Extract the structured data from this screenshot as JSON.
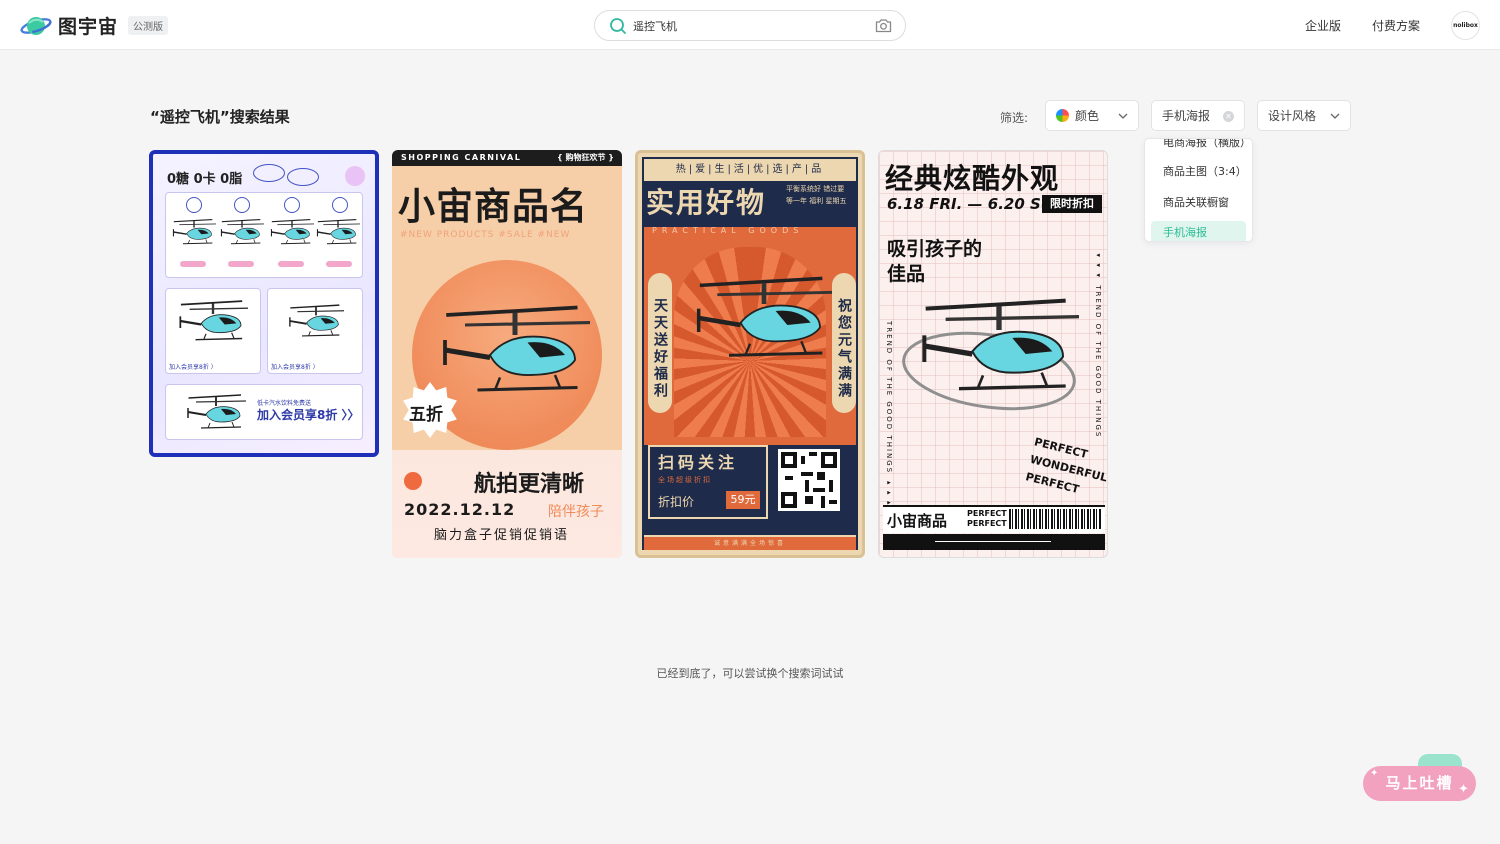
{
  "header": {
    "logo_text": "图宇宙",
    "beta_badge": "公测版",
    "search": {
      "value": "遥控飞机",
      "placeholder": ""
    },
    "nav": [
      "企业版",
      "付费方案"
    ],
    "avatar_text": "nolibox"
  },
  "results": {
    "title": "“遥控飞机”搜索结果",
    "filter_label": "筛选:",
    "filters": {
      "color": "颜色",
      "type": "手机海报",
      "style": "设计风格"
    },
    "dropdown": [
      "电商海报（横版）",
      "商品主图（3:4）",
      "商品关联橱窗",
      "手机海报"
    ],
    "dropdown_selected": "手机海报"
  },
  "cards": [
    {
      "head": "0糖 0卡 0脂",
      "member_small_1": "加入会员享8折 〉",
      "member_small_2": "加入会员享8折 〉",
      "promo_small": "低卡汽水饮料免费送",
      "promo_big": "加入会员享8折 〉〉"
    },
    {
      "top": "SHOPPING CARNIVAL",
      "top_right": "{ 购物狂欢节 }",
      "title": "小宙商品名",
      "sub": "#NEW PRODUCTS   #SALE   #NEW",
      "burst": "五折",
      "headline": "航拍更清晰",
      "date": "2022.12.12",
      "date_right": "陪伴孩子",
      "footer": "脑力盒子促销促销语"
    },
    {
      "stripe": "热|爱|生|活|优|选|产|品",
      "title": "实用好物",
      "mini": "平衡系统好 错过要等一年 福利 星期五",
      "practical": "PRACTICAL  GOODS",
      "left_vertical": "天天送好福利",
      "right_vertical": "祝您元气满满",
      "scan_title": "扫码关注",
      "scan_sub": "全场超级折扣",
      "scan_price_label": "折扣价",
      "price": "59元",
      "footer": "诚意满满全场惊喜"
    },
    {
      "title": "经典炫酷外观",
      "date": "6.18 FRI. — 6.20 SUN.",
      "tag": "限时折扣",
      "headline": "吸引孩子的佳品",
      "vertical_left": "TREND OF THE GOOD THINGS ▸▸▸",
      "vertical_right": "◂◂◂ TREND OF THE GOOD THINGS",
      "perfect": "PERFECT WONDERFUL PERFECT",
      "brand": "小宙商品",
      "brand_perfect": "PERFECT PERFECT"
    }
  ],
  "end_text": "已经到底了，可以尝试换个搜索词试试",
  "feedback_label": "马上吐槽"
}
